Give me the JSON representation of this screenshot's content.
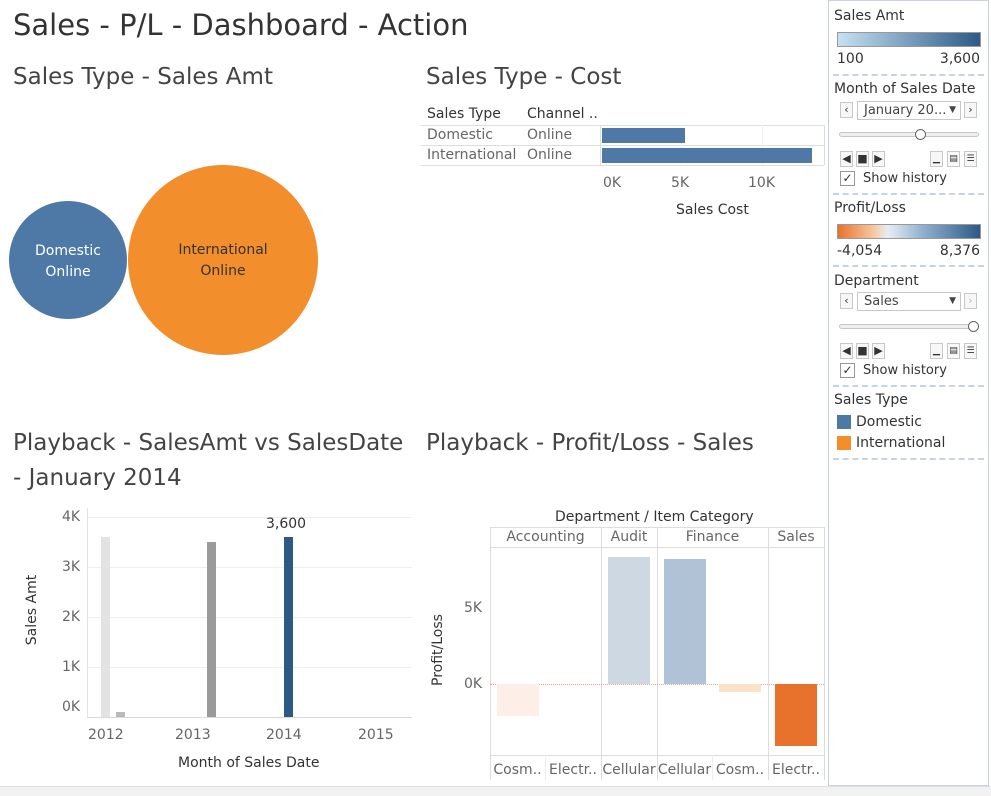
{
  "dashboard": {
    "title": "Sales - P/L - Dashboard - Action"
  },
  "bubble": {
    "title": "Sales Type - Sales Amt",
    "bubbles": [
      {
        "label_line1": "Domestic",
        "label_line2": "Online",
        "color": "#4e79a7"
      },
      {
        "label_line1": "International",
        "label_line2": "Online",
        "color": "#f28e2b"
      }
    ]
  },
  "cost": {
    "title": "Sales Type - Cost",
    "col_headers": [
      "Sales Type",
      "Channel .."
    ],
    "rows": [
      {
        "sales_type": "Domestic",
        "channel": "Online",
        "value": 5200
      },
      {
        "sales_type": "International",
        "channel": "Online",
        "value": 13100
      }
    ],
    "axis_ticks": [
      "0K",
      "5K",
      "10K"
    ],
    "axis_label": "Sales Cost",
    "bar_color": "#4e79a7"
  },
  "playback": {
    "title_line1": "Playback - SalesAmt vs SalesDate",
    "title_line2": "- January 2014",
    "y_ticks": [
      "4K",
      "3K",
      "2K",
      "1K",
      "0K"
    ],
    "y_label": "Sales Amt",
    "x_ticks": [
      "2012",
      "2013",
      "2014",
      "2015"
    ],
    "x_label": "Month of Sales Date",
    "highlight_label": "3,600"
  },
  "profit": {
    "title": "Playback - Profit/Loss - Sales",
    "header": "Department  /  Item Category",
    "departments": [
      "Accounting",
      "Audit",
      "Finance",
      "Sales"
    ],
    "categories": [
      "Cosm..",
      "Electr..",
      "Cellular",
      "Cellular",
      "Cosm..",
      "Electr.."
    ],
    "y_ticks": [
      "5K",
      "0K"
    ],
    "y_label": "Profit/Loss"
  },
  "legends": {
    "sales_amt": {
      "title": "Sales Amt",
      "min": "100",
      "max": "3,600"
    },
    "month_filter": {
      "title": "Month of Sales Date",
      "value": "January 20...",
      "show_history": "Show history"
    },
    "profit_loss": {
      "title": "Profit/Loss",
      "min": "-4,054",
      "max": "8,376"
    },
    "department": {
      "title": "Department",
      "value": "Sales",
      "show_history": "Show history"
    },
    "sales_type": {
      "title": "Sales Type",
      "items": [
        "Domestic",
        "International"
      ],
      "colors": [
        "#4e79a7",
        "#f28e2b"
      ]
    }
  },
  "chart_data": [
    {
      "type": "bar",
      "title": "Sales Type - Cost",
      "categories": [
        "Domestic / Online",
        "International / Online"
      ],
      "values": [
        5200,
        13100
      ],
      "xlabel": "Sales Cost",
      "xlim": [
        0,
        14000
      ]
    },
    {
      "type": "bar",
      "title": "Playback - SalesAmt vs SalesDate - January 2014",
      "x": [
        "Jan 2012",
        "Mar 2012",
        "Jan 2013",
        "Jan 2014"
      ],
      "values": [
        3600,
        100,
        3500,
        3600
      ],
      "xlabel": "Month of Sales Date",
      "ylabel": "Sales Amt",
      "ylim": [
        0,
        4000
      ]
    },
    {
      "type": "bar",
      "title": "Playback - Profit/Loss - Sales",
      "categories": [
        "Accounting / Cosm..",
        "Accounting / Electr..",
        "Audit / Cellular",
        "Finance / Cellular",
        "Finance / Cosm..",
        "Sales / Electr.."
      ],
      "values": [
        -2100,
        0,
        8376,
        8200,
        -500,
        -4054
      ],
      "ylabel": "Profit/Loss",
      "ylim": [
        -5500,
        9000
      ]
    }
  ]
}
